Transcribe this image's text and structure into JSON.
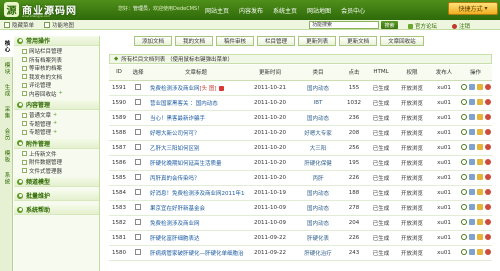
{
  "header": {
    "logo_mark": "源",
    "logo_text": "商业源码网",
    "logo_sub": "www.shangye.com",
    "welcome_prefix": "您好：",
    "welcome_user": "管理员",
    "welcome_suffix": "，欢迎使用DedeCMS！",
    "nav": [
      "网站主页",
      "内容发布",
      "系统主页",
      "网站地图",
      "会员中心"
    ],
    "quick_button": "快捷方式"
  },
  "subbar": {
    "hide_menu": "隐藏菜单",
    "function_map": "功能地图",
    "search_placeholder": "功能搜索",
    "search_button": "搜索",
    "site_home": "官方论坛",
    "logout": "注销"
  },
  "vtabs": [
    "核心",
    "模块",
    "生成",
    "采集",
    "会员",
    "模板",
    "系统"
  ],
  "sidebar": {
    "sections": [
      {
        "title": "常用操作",
        "items": [
          "网站栏目管理",
          "所有档案列表",
          "等审核的档案",
          "我发布的文档",
          "评论管理",
          "内容回收站"
        ]
      },
      {
        "title": "内容管理",
        "items": [
          "普通文章",
          "专题管理",
          "专题管理"
        ]
      },
      {
        "title": "附件管理",
        "items": [
          "上传新文件",
          "附件数据管理",
          "文件式管理器"
        ]
      },
      {
        "title": "频道模型",
        "items": []
      },
      {
        "title": "批量维护",
        "items": []
      },
      {
        "title": "系统帮助",
        "items": []
      }
    ]
  },
  "actions": [
    "添加文档",
    "我的文档",
    "稿件审核",
    "栏目管理",
    "更新列表",
    "更新文档",
    "文章回收站"
  ],
  "crumb": "所有栏目文档列表 （使用鼠标右键弹出菜单）",
  "table": {
    "headers": [
      "ID",
      "选择",
      "文章标题",
      "更新时间",
      "类目",
      "点击",
      "HTML",
      "权限",
      "发布人",
      "操作"
    ],
    "rows": [
      {
        "id": "1591",
        "title": "免费检测涉及商业网",
        "tag": "[头 图]",
        "icon": true,
        "date": "2011-10-21",
        "cat": "国内动态",
        "clicks": "155",
        "html": "已生成",
        "perm": "开放浏览",
        "author": "xu01"
      },
      {
        "id": "1590",
        "title": "营业国家黑客关 ：国内动态",
        "tag": "",
        "icon": false,
        "date": "2011-10-20",
        "cat": "IBT",
        "clicks": "1032",
        "html": "已生成",
        "perm": "开放浏览",
        "author": "xu01"
      },
      {
        "id": "1589",
        "title": "当心！黑客最新诈骗手",
        "tag": "",
        "icon": false,
        "date": "2011-10-20",
        "cat": "国内动态",
        "clicks": "236",
        "html": "已生成",
        "perm": "开放浏览",
        "author": "xu01"
      },
      {
        "id": "1588",
        "title": "好嗯大新公司何可？",
        "tag": "",
        "icon": false,
        "date": "2011-10-20",
        "cat": "好嗯大专家",
        "clicks": "208",
        "html": "已生成",
        "perm": "开放浏览",
        "author": "xu01"
      },
      {
        "id": "1587",
        "title": "乙肝大三阳如何区别",
        "tag": "",
        "icon": false,
        "date": "2011-10-20",
        "cat": "大三阳",
        "clicks": "256",
        "html": "已生成",
        "perm": "开放浏览",
        "author": "xu01"
      },
      {
        "id": "1586",
        "title": "肝硬化晚期如何延高生活质量",
        "tag": "",
        "icon": false,
        "date": "2011-10-20",
        "cat": "肝硬化保健",
        "clicks": "195",
        "html": "已生成",
        "perm": "开放浏览",
        "author": "xu01"
      },
      {
        "id": "1585",
        "title": "丙肝真的会传染吗？",
        "tag": "",
        "icon": false,
        "date": "2011-10-20",
        "cat": "丙肝",
        "clicks": "226",
        "html": "已生成",
        "perm": "开放浏览",
        "author": "xu01"
      },
      {
        "id": "1584",
        "title": "好消息！免费检测涉及商业网2011年10月2日",
        "tag": "[图]",
        "icon": true,
        "date": "2011-10-19",
        "cat": "国内动态",
        "clicks": "188",
        "html": "已生成",
        "perm": "开放浏览",
        "author": "xu01"
      },
      {
        "id": "1583",
        "title": "果京宜在好肝新基金会",
        "tag": "",
        "icon": false,
        "date": "2011-10-09",
        "cat": "国内动态",
        "clicks": "278",
        "html": "已生成",
        "perm": "开放浏览",
        "author": "xu01"
      },
      {
        "id": "1582",
        "title": "免费检测涉及商业网",
        "tag": "",
        "icon": false,
        "date": "2011-10-09",
        "cat": "国内动态",
        "clicks": "204",
        "html": "已生成",
        "perm": "开放浏览",
        "author": "xu01"
      },
      {
        "id": "1581",
        "title": "肝硬化富肝细胞表达",
        "tag": "",
        "icon": false,
        "date": "2011-09-22",
        "cat": "肝硬化表",
        "clicks": "226",
        "html": "已生成",
        "perm": "开放浏览",
        "author": "xu01"
      },
      {
        "id": "1580",
        "title": "肝病病管家破肝硬化—肝硬化单细胞治",
        "tag": "",
        "icon": false,
        "date": "2011-09-22",
        "cat": "肝硬化治疗",
        "clicks": "243",
        "html": "已生成",
        "perm": "开放浏览",
        "author": "xu01"
      }
    ]
  },
  "colors": {
    "header_green": "#3b7a12",
    "accent_orange": "#f0b020",
    "title_blue": "#1a5aa0"
  }
}
